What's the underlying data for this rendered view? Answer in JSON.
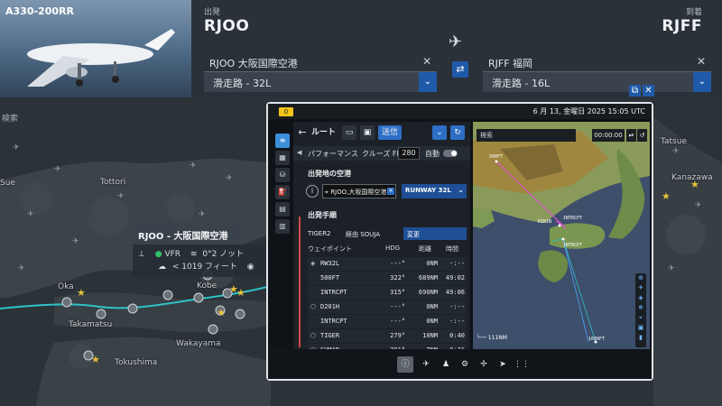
{
  "flight": {
    "aircraft_type": "A330-200RR",
    "departure": {
      "label": "出発",
      "code": "RJOO",
      "airport": "RJOO 大阪国際空港",
      "runway": "滑走路 - 32L"
    },
    "arrival": {
      "label": "到着",
      "code": "RJFF",
      "airport": "RJFF 福岡",
      "runway": "滑走路 - 16L"
    }
  },
  "map": {
    "search_label": "検索",
    "labels": [
      "Tottori",
      "Kobe",
      "Takamatsu",
      "Wakayama",
      "Tokushima",
      "Tatsue",
      "Kanazawa",
      "Oka",
      "Sue"
    ]
  },
  "tooltip": {
    "title": "RJOO - 大阪国際空港",
    "rules": "VFR",
    "wind": "0°2 ノット",
    "cloud": "< 1019 フィート"
  },
  "efb": {
    "status_badge": "0",
    "date_time": "6 月 13, 金曜日 2025 15:05 UTC",
    "toolbar": {
      "back_icon": "←",
      "title": "ルート",
      "send_label": "送信"
    },
    "performance": {
      "label": "パフォーマンス",
      "cruise_label": "クルーズ FL",
      "cruise_value": "280",
      "auto_label": "自動"
    },
    "departure_section": {
      "title": "出発地の空港",
      "airport": "RJOO,大阪国際空港",
      "runway": "RUNWAY 32L"
    },
    "procedure": {
      "title": "出発手順",
      "name": "TIGER2",
      "via": "経由 SOUJA",
      "change_label": "変更"
    },
    "waypoint_header": {
      "name": "ウェイポイント",
      "hdg": "HDG",
      "dist": "距離",
      "time": "時間"
    },
    "waypoints": [
      {
        "icon": "◈",
        "name": "RW32L",
        "hdg": "---°",
        "dist": "0NM",
        "time": "-:--"
      },
      {
        "icon": "",
        "name": "500FT",
        "hdg": "322°",
        "dist": "689NM",
        "time": "49:02"
      },
      {
        "icon": "",
        "name": "INTRCPT",
        "hdg": "315°",
        "dist": "690NM",
        "time": "49:06"
      },
      {
        "icon": "⬡",
        "name": "D201H",
        "hdg": "---°",
        "dist": "0NM",
        "time": "-:--"
      },
      {
        "icon": "",
        "name": "INTRCPT",
        "hdg": "---°",
        "dist": "0NM",
        "time": "-:--"
      },
      {
        "icon": "⬡",
        "name": "TIGER",
        "hdg": "279°",
        "dist": "10NM",
        "time": "0:40"
      },
      {
        "icon": "⬡",
        "name": "SUMAR",
        "hdg": "291°",
        "dist": "7NM",
        "time": "0:31"
      }
    ],
    "map": {
      "search_label": "検索",
      "timer": "00:00:00",
      "scale": "111NM",
      "labels": {
        "top": "500FT",
        "kirin": "KIRIN",
        "intrcpt1": "INTRCPT",
        "intrcpt2": "INTRCPT",
        "s1": "1600FT"
      }
    }
  },
  "colors": {
    "accent": "#2e6fc5",
    "route_magenta": "#e24fd6",
    "route_cyan": "#2fc2c9",
    "active_tab": "#3b8fd9"
  }
}
